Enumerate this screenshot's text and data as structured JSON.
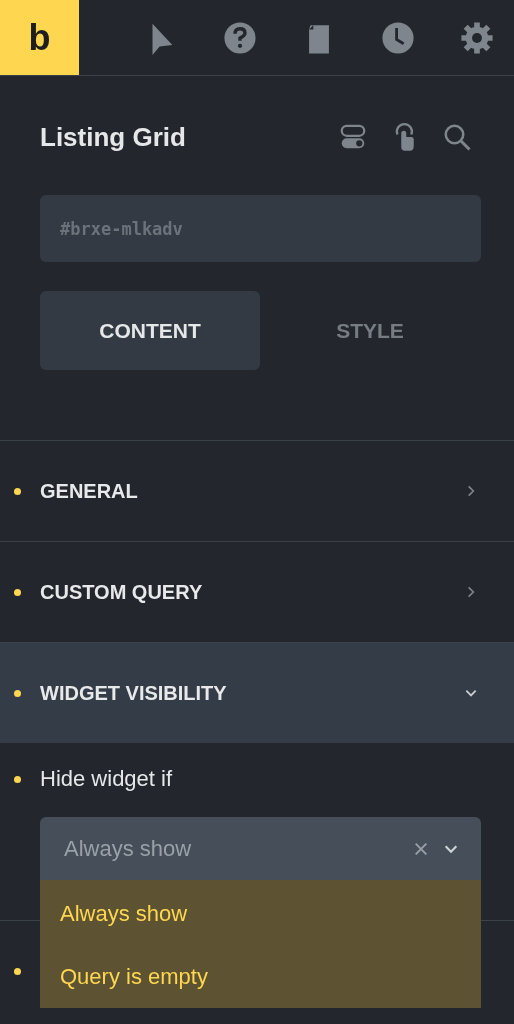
{
  "toolbar": {
    "logo": "b"
  },
  "element": {
    "title": "Listing Grid"
  },
  "id_field": {
    "placeholder": "#brxe-mlkadv"
  },
  "tabs": [
    {
      "label": "CONTENT",
      "selected": true
    },
    {
      "label": "STYLE",
      "selected": false
    }
  ],
  "sections": [
    {
      "label": "GENERAL",
      "modified": true,
      "expanded": false
    },
    {
      "label": "CUSTOM QUERY",
      "modified": true,
      "expanded": false
    },
    {
      "label": "WIDGET VISIBILITY",
      "modified": true,
      "expanded": true
    }
  ],
  "control": {
    "label": "Hide widget if",
    "modified": true,
    "select": {
      "placeholder": "Always show",
      "open": true,
      "options": [
        "Always show",
        "Query is empty"
      ]
    }
  },
  "next_row": {
    "modified": true
  }
}
